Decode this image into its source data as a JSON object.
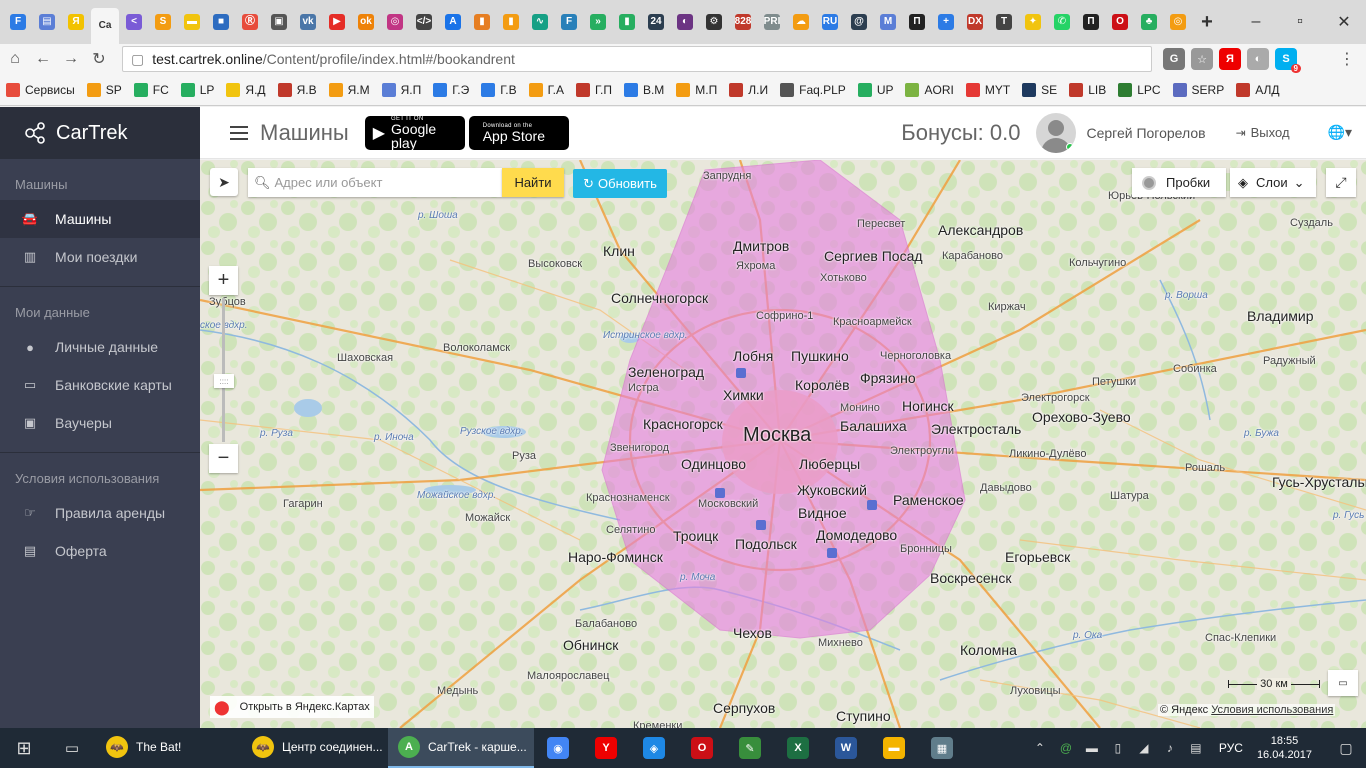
{
  "browser": {
    "url_host": "test.cartrek.online",
    "url_path": "/Content/profile/index.html#/bookandrent",
    "active_tab_label": "Ca",
    "tab_icons": [
      {
        "name": "tab-f",
        "glyph": "F",
        "color": "#2c7be5"
      },
      {
        "name": "tab-doc",
        "glyph": "▤",
        "color": "#5b7ed6"
      },
      {
        "name": "tab-yandex",
        "glyph": "Я",
        "color": "#f2c200"
      },
      {
        "name": "tab-share",
        "glyph": "<",
        "color": "#7a5bd6"
      },
      {
        "name": "tab-s",
        "glyph": "S",
        "color": "#f39c12"
      },
      {
        "name": "tab-yd",
        "glyph": "▬",
        "color": "#f1c40f"
      },
      {
        "name": "tab-puzzle",
        "glyph": "■",
        "color": "#2d6cc0"
      },
      {
        "name": "tab-r",
        "glyph": "Ⓡ",
        "color": "#e74c3c"
      },
      {
        "name": "tab-save",
        "glyph": "▣",
        "color": "#555"
      },
      {
        "name": "tab-vk",
        "glyph": "vk",
        "color": "#4a76a8"
      },
      {
        "name": "tab-youtube",
        "glyph": "▶",
        "color": "#e52d27"
      },
      {
        "name": "tab-ok",
        "glyph": "ok",
        "color": "#ee8208"
      },
      {
        "name": "tab-instagram",
        "glyph": "◎",
        "color": "#c13584"
      },
      {
        "name": "tab-code",
        "glyph": "</>",
        "color": "#444"
      },
      {
        "name": "tab-a",
        "glyph": "A",
        "color": "#1a73e8"
      },
      {
        "name": "tab-bars",
        "glyph": "▮",
        "color": "#e67e22"
      },
      {
        "name": "tab-bars2",
        "glyph": "▮",
        "color": "#f39c12"
      },
      {
        "name": "tab-pulse",
        "glyph": "∿",
        "color": "#16a085"
      },
      {
        "name": "tab-f2",
        "glyph": "F",
        "color": "#2980b9"
      },
      {
        "name": "tab-arrows",
        "glyph": "»",
        "color": "#27ae60"
      },
      {
        "name": "tab-chart",
        "glyph": "▮",
        "color": "#27ae60"
      },
      {
        "name": "tab-24",
        "glyph": "24",
        "color": "#2c3e50"
      },
      {
        "name": "tab-circle",
        "glyph": "◐",
        "color": "#6c3483"
      },
      {
        "name": "tab-gear",
        "glyph": "⚙",
        "color": "#333"
      },
      {
        "name": "tab-828",
        "glyph": "828",
        "color": "#c0392b"
      },
      {
        "name": "tab-pri",
        "glyph": "PRI",
        "color": "#7f8c8d"
      },
      {
        "name": "tab-cloud",
        "glyph": "☁",
        "color": "#f39c12"
      },
      {
        "name": "tab-ru",
        "glyph": "RU",
        "color": "#2c7be5"
      },
      {
        "name": "tab-spiral",
        "glyph": "@",
        "color": "#2c3e50"
      },
      {
        "name": "tab-m",
        "glyph": "M",
        "color": "#5b7ed6"
      },
      {
        "name": "tab-p",
        "glyph": "П",
        "color": "#222"
      },
      {
        "name": "tab-plus",
        "glyph": "+",
        "color": "#2c7be5"
      },
      {
        "name": "tab-dx",
        "glyph": "DX",
        "color": "#c0392b"
      },
      {
        "name": "tab-t",
        "glyph": "T",
        "color": "#444"
      },
      {
        "name": "tab-cross",
        "glyph": "✦",
        "color": "#f1c40f"
      },
      {
        "name": "tab-whatsapp",
        "glyph": "✆",
        "color": "#25d366"
      },
      {
        "name": "tab-p2",
        "glyph": "П",
        "color": "#222"
      },
      {
        "name": "tab-opera",
        "glyph": "O",
        "color": "#cc0f16"
      },
      {
        "name": "tab-plant",
        "glyph": "♣",
        "color": "#27ae60"
      },
      {
        "name": "tab-ring",
        "glyph": "◎",
        "color": "#f39c12"
      }
    ],
    "extensions": [
      {
        "name": "translate",
        "glyph": "G",
        "color": "#777"
      },
      {
        "name": "star",
        "glyph": "☆",
        "color": "#999"
      },
      {
        "name": "yandex",
        "glyph": "Я",
        "color": "#e00"
      },
      {
        "name": "user",
        "glyph": "◐",
        "color": "#aaa"
      },
      {
        "name": "skype",
        "glyph": "S",
        "color": "#00aff0"
      }
    ],
    "skype_badge": "9"
  },
  "bookmarks": [
    {
      "label": "Сервисы",
      "color": "#e74c3c"
    },
    {
      "label": "SP",
      "color": "#f39c12"
    },
    {
      "label": "FC",
      "color": "#27ae60"
    },
    {
      "label": "LP",
      "color": "#27ae60"
    },
    {
      "label": "Я.Д",
      "color": "#f1c40f"
    },
    {
      "label": "Я.В",
      "color": "#c0392b"
    },
    {
      "label": "Я.М",
      "color": "#f39c12"
    },
    {
      "label": "Я.П",
      "color": "#5b7ed6"
    },
    {
      "label": "Г.Э",
      "color": "#2c7be5"
    },
    {
      "label": "Г.В",
      "color": "#2c7be5"
    },
    {
      "label": "Г.А",
      "color": "#f39c12"
    },
    {
      "label": "Г.П",
      "color": "#c0392b"
    },
    {
      "label": "В.М",
      "color": "#2c7be5"
    },
    {
      "label": "М.П",
      "color": "#f39c12"
    },
    {
      "label": "Л.И",
      "color": "#c0392b"
    },
    {
      "label": "Faq.PLP",
      "color": "#555"
    },
    {
      "label": "UP",
      "color": "#27ae60"
    },
    {
      "label": "AORI",
      "color": "#7cb342"
    },
    {
      "label": "MYT",
      "color": "#e53935"
    },
    {
      "label": "SE",
      "color": "#1e3a5f"
    },
    {
      "label": "LIB",
      "color": "#c0392b"
    },
    {
      "label": "LPC",
      "color": "#2e7d32"
    },
    {
      "label": "SERP",
      "color": "#5c6bc0"
    },
    {
      "label": "АЛД",
      "color": "#c0392b"
    }
  ],
  "sidebar": {
    "brand": "CarTrek",
    "sections": [
      {
        "title": "Машины",
        "items": [
          {
            "label": "Машины",
            "icon": "car-icon",
            "glyph": "🚘",
            "active": true
          },
          {
            "label": "Мои поездки",
            "icon": "bar-chart-icon",
            "glyph": "▥",
            "active": false
          }
        ]
      },
      {
        "title": "Мои данные",
        "items": [
          {
            "label": "Личные данные",
            "icon": "user-icon",
            "glyph": "●",
            "active": false
          },
          {
            "label": "Банковские карты",
            "icon": "credit-card-icon",
            "glyph": "▭",
            "active": false
          },
          {
            "label": "Ваучеры",
            "icon": "voucher-icon",
            "glyph": "▣",
            "active": false
          }
        ]
      },
      {
        "title": "Условия использования",
        "items": [
          {
            "label": "Правила аренды",
            "icon": "hand-icon",
            "glyph": "☞",
            "active": false
          },
          {
            "label": "Оферта",
            "icon": "document-icon",
            "glyph": "▤",
            "active": false
          }
        ]
      }
    ]
  },
  "topbar": {
    "title": "Машины",
    "google_play_small": "GET IT ON",
    "google_play_big": "Google play",
    "app_store_small": "Download on the",
    "app_store_big": "App Store",
    "bonus": "Бонусы: 0.0",
    "user_name": "Сергей Погорелов",
    "logout": "Выход"
  },
  "map": {
    "search_placeholder": "Адрес или объект",
    "find_label": "Найти",
    "refresh_label": "Обновить",
    "traffic_label": "Пробки",
    "layers_label": "Слои",
    "open_ymaps": "Открыть в Яндекс.Картах",
    "scale": "30 км",
    "copyright": "© Яндекс",
    "terms": "Условия использования",
    "zone_color": "#e67fe0",
    "labels": [
      {
        "text": "Москва",
        "cls": "city"
      },
      {
        "text": "Запрудня",
        "cls": "small"
      },
      {
        "text": "Дмитров",
        "cls": "big"
      },
      {
        "text": "Яхрома",
        "cls": "small"
      },
      {
        "text": "Сергиев Посад",
        "cls": "big"
      },
      {
        "text": "Хотьково",
        "cls": "small"
      },
      {
        "text": "Пересвет",
        "cls": "small"
      },
      {
        "text": "Александров",
        "cls": "big"
      },
      {
        "text": "Карабаново",
        "cls": "small"
      },
      {
        "text": "Кольчугино",
        "cls": "small"
      },
      {
        "text": "Юрьев-Польский",
        "cls": "small"
      },
      {
        "text": "Суздаль",
        "cls": "small"
      },
      {
        "text": "Клин",
        "cls": "big"
      },
      {
        "text": "Высоковск",
        "cls": "small"
      },
      {
        "text": "Солнечногорск",
        "cls": "big"
      },
      {
        "text": "Софрино-1",
        "cls": "small"
      },
      {
        "text": "Красноармейск",
        "cls": "small"
      },
      {
        "text": "Киржач",
        "cls": "small"
      },
      {
        "text": "Владимир",
        "cls": "big"
      },
      {
        "text": "Зубцов",
        "cls": "small"
      },
      {
        "text": "Шаховская",
        "cls": "small"
      },
      {
        "text": "Волоколамск",
        "cls": "small"
      },
      {
        "text": "Лобня",
        "cls": "big"
      },
      {
        "text": "Пушкино",
        "cls": "big"
      },
      {
        "text": "Черноголовка",
        "cls": "small"
      },
      {
        "text": "Зеленоград",
        "cls": "big"
      },
      {
        "text": "Истра",
        "cls": "small"
      },
      {
        "text": "Химки",
        "cls": "big"
      },
      {
        "text": "Королёв",
        "cls": "big"
      },
      {
        "text": "Фрязино",
        "cls": "big"
      },
      {
        "text": "Петушки",
        "cls": "small"
      },
      {
        "text": "Радужный",
        "cls": "small"
      },
      {
        "text": "Собинка",
        "cls": "small"
      },
      {
        "text": "Монино",
        "cls": "small"
      },
      {
        "text": "Ногинск",
        "cls": "big"
      },
      {
        "text": "Электрогорск",
        "cls": "small"
      },
      {
        "text": "Орехово-Зуево",
        "cls": "big"
      },
      {
        "text": "Красногорск",
        "cls": "big"
      },
      {
        "text": "Балашиха",
        "cls": "big"
      },
      {
        "text": "Электросталь",
        "cls": "big"
      },
      {
        "text": "Звенигород",
        "cls": "small"
      },
      {
        "text": "Руза",
        "cls": "small"
      },
      {
        "text": "Одинцово",
        "cls": "big"
      },
      {
        "text": "Люберцы",
        "cls": "big"
      },
      {
        "text": "Электроугли",
        "cls": "small"
      },
      {
        "text": "Ликино-Дулёво",
        "cls": "small"
      },
      {
        "text": "Рошаль",
        "cls": "small"
      },
      {
        "text": "Гусь-Хрустальный",
        "cls": "big"
      },
      {
        "text": "Жуковский",
        "cls": "big"
      },
      {
        "text": "Раменское",
        "cls": "big"
      },
      {
        "text": "Давыдово",
        "cls": "small"
      },
      {
        "text": "Шатура",
        "cls": "small"
      },
      {
        "text": "Гагарин",
        "cls": "small"
      },
      {
        "text": "Можайск",
        "cls": "small"
      },
      {
        "text": "Краснознаменск",
        "cls": "small"
      },
      {
        "text": "Московский",
        "cls": "small"
      },
      {
        "text": "Видное",
        "cls": "big"
      },
      {
        "text": "Селятино",
        "cls": "small"
      },
      {
        "text": "Троицк",
        "cls": "big"
      },
      {
        "text": "Подольск",
        "cls": "big"
      },
      {
        "text": "Домодедово",
        "cls": "big"
      },
      {
        "text": "Бронницы",
        "cls": "small"
      },
      {
        "text": "Наро-Фоминск",
        "cls": "big"
      },
      {
        "text": "Егорьевск",
        "cls": "big"
      },
      {
        "text": "Воскресенск",
        "cls": "big"
      },
      {
        "text": "Балабаново",
        "cls": "small"
      },
      {
        "text": "Обнинск",
        "cls": "big"
      },
      {
        "text": "Чехов",
        "cls": "big"
      },
      {
        "text": "Михнево",
        "cls": "small"
      },
      {
        "text": "Коломна",
        "cls": "big"
      },
      {
        "text": "Спас-Клепики",
        "cls": "small"
      },
      {
        "text": "Малоярославец",
        "cls": "small"
      },
      {
        "text": "Медынь",
        "cls": "small"
      },
      {
        "text": "Серпухов",
        "cls": "big"
      },
      {
        "text": "Кременки",
        "cls": "small"
      },
      {
        "text": "Ступино",
        "cls": "big"
      },
      {
        "text": "Луховицы",
        "cls": "small"
      },
      {
        "text": "Истринское вдхр.",
        "cls": "water"
      },
      {
        "text": "Рузское вдхр.",
        "cls": "water"
      },
      {
        "text": "Можайское вдхр.",
        "cls": "water"
      },
      {
        "text": "р. Шоша",
        "cls": "water"
      },
      {
        "text": "р. Руза",
        "cls": "water"
      },
      {
        "text": "р. Иноча",
        "cls": "water"
      },
      {
        "text": "р. Моча",
        "cls": "water"
      },
      {
        "text": "р. Ока",
        "cls": "water"
      },
      {
        "text": "р. Ворша",
        "cls": "water"
      },
      {
        "text": "р. Бужа",
        "cls": "water"
      },
      {
        "text": "р. Гусь",
        "cls": "water"
      },
      {
        "text": "ское вдхр.",
        "cls": "water"
      }
    ]
  },
  "taskbar": {
    "tasks": [
      {
        "label": "The Bat!",
        "glyph": "🦇",
        "color": "#f1c40f",
        "active": false
      },
      {
        "label": "Центр соединен...",
        "glyph": "🦇",
        "color": "#f1c40f",
        "active": false
      },
      {
        "label": "CarTrek - карше...",
        "glyph": "A",
        "color": "#4caf50",
        "active": true
      }
    ],
    "pinned": [
      {
        "name": "chrome",
        "glyph": "◉",
        "color": "#4285f4"
      },
      {
        "name": "yandex-browser",
        "glyph": "Y",
        "color": "#e00"
      },
      {
        "name": "safari",
        "glyph": "◈",
        "color": "#1e88e5"
      },
      {
        "name": "opera",
        "glyph": "O",
        "color": "#cc0f16"
      },
      {
        "name": "notepad",
        "glyph": "✎",
        "color": "#388e3c"
      },
      {
        "name": "excel",
        "glyph": "X",
        "color": "#1d6f42"
      },
      {
        "name": "word",
        "glyph": "W",
        "color": "#2b579a"
      },
      {
        "name": "explorer",
        "glyph": "▬",
        "color": "#f4b400"
      },
      {
        "name": "calculator",
        "glyph": "▦",
        "color": "#607d8b"
      }
    ],
    "lang": "РУС",
    "time": "18:55",
    "date": "16.04.2017"
  }
}
